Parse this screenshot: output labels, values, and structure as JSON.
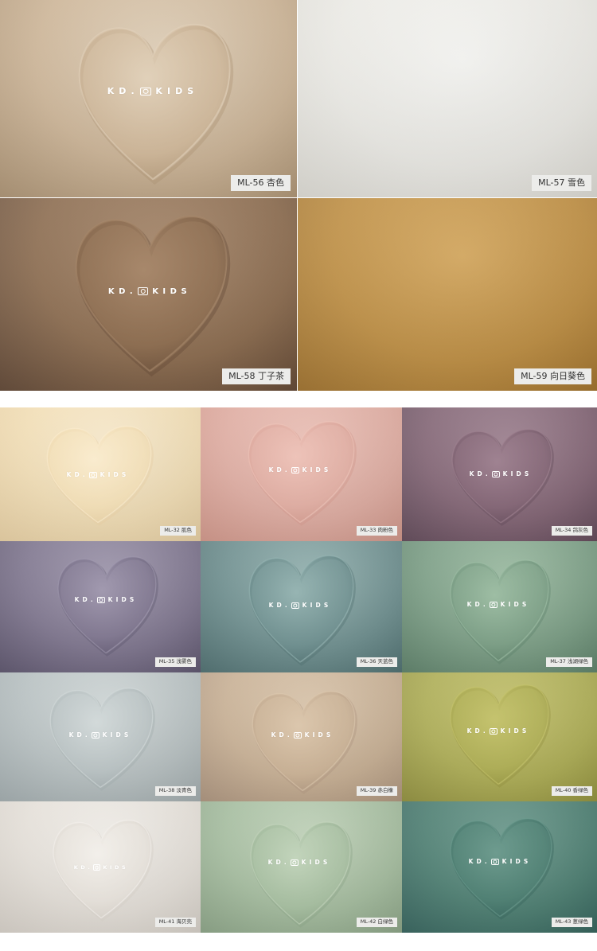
{
  "brand": "KD.  KIDS",
  "brand_text": {
    "left": "KD.",
    "right": "KIDS"
  },
  "icons": {
    "brand_camera": "camera-icon",
    "swatch_heart": "heart-icon"
  },
  "top_swatches": [
    {
      "code": "ML-56",
      "name": "杏色",
      "label": "ML-56  杏色",
      "base": "#cdb597",
      "light": "#e2d2bb",
      "dark": "#a99071"
    },
    {
      "code": "ML-57",
      "name": "雪色",
      "label": "ML-57  雪色",
      "base": "#ecebe6",
      "light": "#f8f8f5",
      "dark": "#d9d7d0"
    },
    {
      "code": "ML-58",
      "name": "丁子茶",
      "label": "ML-58  丁子茶",
      "base": "#8c6c4f",
      "light": "#a8886b",
      "dark": "#5e4533"
    },
    {
      "code": "ML-59",
      "name": "向日葵色",
      "label": "ML-59  向日葵色",
      "base": "#bf8f43",
      "light": "#d7a95e",
      "dark": "#9c6f2c"
    }
  ],
  "bottom_swatches": [
    {
      "code": "ML-32",
      "name": "肌色",
      "label": "ML-32  肌色",
      "base": "#f3dfb6",
      "light": "#fbedd0",
      "dark": "#e4cca0"
    },
    {
      "code": "ML-33",
      "name": "肉粉色",
      "label": "ML-33  肉粉色",
      "base": "#e0ada2",
      "light": "#efc4ba",
      "dark": "#cd9386"
    },
    {
      "code": "ML-34",
      "name": "鸽灰色",
      "label": "ML-34  鸽灰色",
      "base": "#836575",
      "light": "#a08392",
      "dark": "#5e4756"
    },
    {
      "code": "ML-35",
      "name": "浅雾色",
      "label": "ML-35  浅雾色",
      "base": "#7f768f",
      "light": "#a29ab0",
      "dark": "#5a526a"
    },
    {
      "code": "ML-36",
      "name": "天蓝色",
      "label": "ML-36  天蓝色",
      "base": "#6f9090",
      "light": "#98b6b4",
      "dark": "#4c6c6d"
    },
    {
      "code": "ML-37",
      "name": "浅湖绿色",
      "label": "ML-37  浅湖绿色",
      "base": "#7c9f86",
      "light": "#9fbfa5",
      "dark": "#5a7d66"
    },
    {
      "code": "ML-38",
      "name": "淡青色",
      "label": "ML-38  淡青色",
      "base": "#b9c2c3",
      "light": "#d4dbdb",
      "dark": "#9ea8aa"
    },
    {
      "code": "ML-39",
      "name": "赤白橡",
      "label": "ML-39  赤白橡",
      "base": "#c9b195",
      "light": "#ddc8ae",
      "dark": "#a8907a"
    },
    {
      "code": "ML-40",
      "name": "香绿色",
      "label": "ML-40  香绿色",
      "base": "#aeae55",
      "light": "#c6c46e",
      "dark": "#8e8d3c"
    },
    {
      "code": "ML-41",
      "name": "海贝壳",
      "label": "ML-41  海贝壳",
      "base": "#e6e1da",
      "light": "#f4f1ec",
      "dark": "#d2ccc4"
    },
    {
      "code": "ML-42",
      "name": "白绿色",
      "label": "ML-42  白绿色",
      "base": "#a6bea0",
      "light": "#c4d6bd",
      "dark": "#88a083"
    },
    {
      "code": "ML-43",
      "name": "葱绿色",
      "label": "ML-43  葱绿色",
      "base": "#4d7f72",
      "light": "#6e9c8f",
      "dark": "#33605a"
    }
  ]
}
